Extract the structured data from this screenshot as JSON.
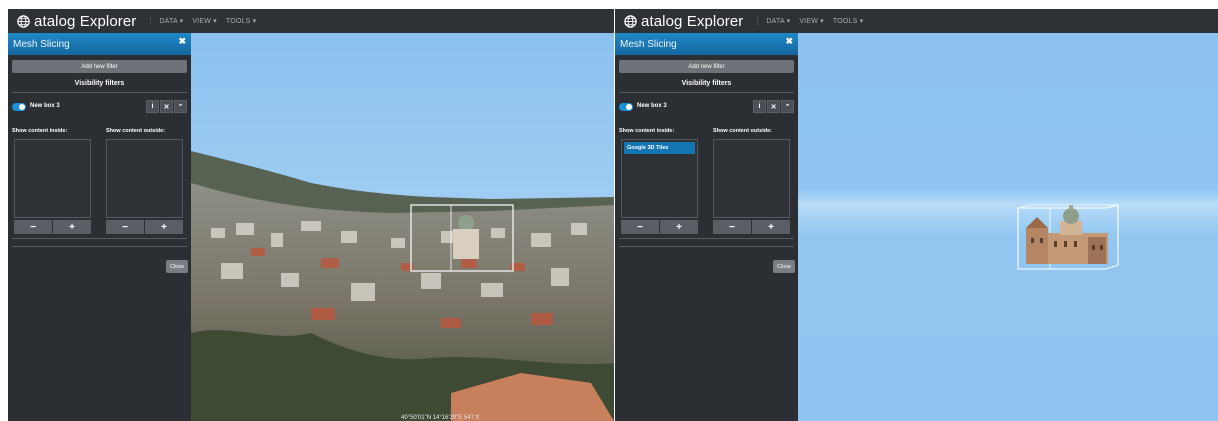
{
  "app": {
    "title": "atalog Explorer",
    "menu": [
      "DATA ▾",
      "VIEW ▾",
      "TOOLS ▾"
    ]
  },
  "panel": {
    "title": "Mesh Slicing",
    "add_button": "Add new filter",
    "section_title": "Visibility filters",
    "filter_name": "New box 3",
    "inside_label": "Show content inside:",
    "outside_label": "Show content outside:",
    "minus": "−",
    "plus": "+",
    "close_button": "Close"
  },
  "right": {
    "inside_items": [
      "Google 3D Tiles"
    ]
  },
  "status": {
    "coords": "40°50'01\"N 14°16'29\"E 547 ft"
  },
  "colors": {
    "accent": "#1e88c9",
    "sky": "#8fc4f1"
  }
}
